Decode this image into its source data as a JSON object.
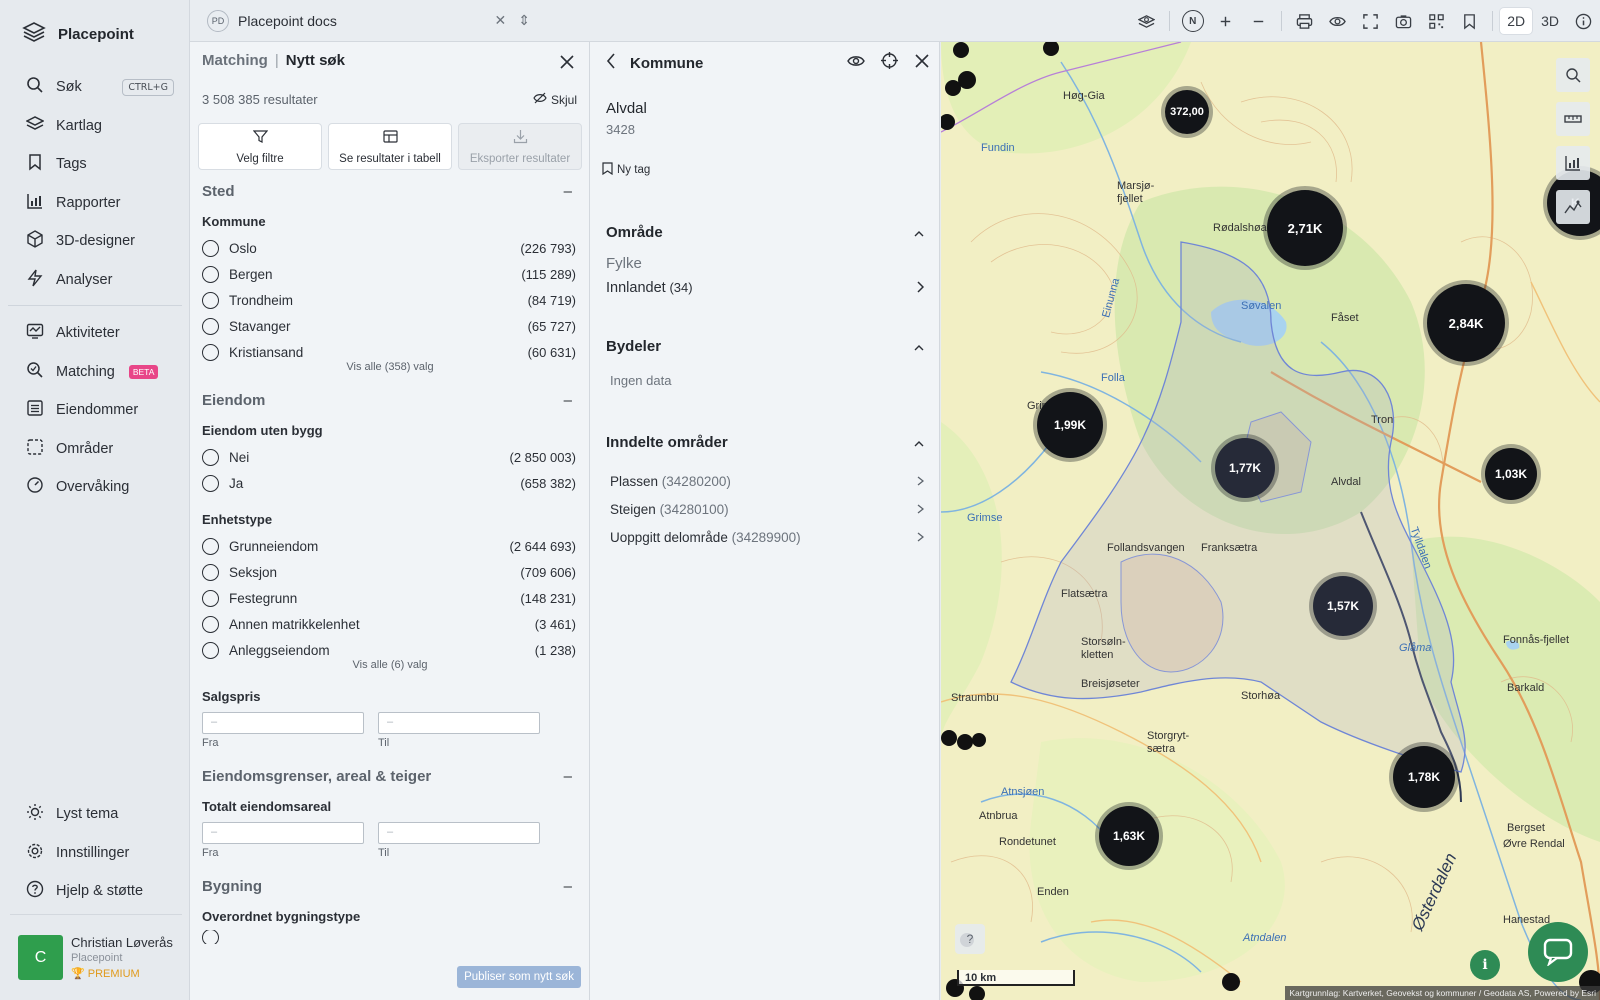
{
  "sidebar": {
    "brand": "Placepoint",
    "nav_main": [
      {
        "label": "Søk",
        "icon": "search-icon",
        "shortcut": "CTRL+G"
      },
      {
        "label": "Kartlag",
        "icon": "layers-icon"
      },
      {
        "label": "Tags",
        "icon": "bookmark-icon"
      },
      {
        "label": "Rapporter",
        "icon": "bar-chart-icon"
      },
      {
        "label": "3D-designer",
        "icon": "cube-icon"
      },
      {
        "label": "Analyser",
        "icon": "lightning-icon"
      }
    ],
    "nav_secondary": [
      {
        "label": "Aktiviteter",
        "icon": "activity-icon"
      },
      {
        "label": "Matching",
        "icon": "match-search-icon",
        "badge": "BETA"
      },
      {
        "label": "Eiendommer",
        "icon": "list-icon"
      },
      {
        "label": "Områder",
        "icon": "area-icon"
      },
      {
        "label": "Overvåking",
        "icon": "gauge-icon"
      }
    ],
    "nav_bottom": [
      {
        "label": "Lyst tema",
        "icon": "sun-icon"
      },
      {
        "label": "Innstillinger",
        "icon": "gear-icon"
      },
      {
        "label": "Hjelp & støtte",
        "icon": "help-icon"
      }
    ],
    "user": {
      "initial": "C",
      "name": "Christian Løverås",
      "org": "Placepoint",
      "plan": "PREMIUM"
    }
  },
  "topbar": {
    "doc_initials": "PD",
    "doc_title": "Placepoint docs",
    "compass": "N",
    "mode_2d": "2D",
    "mode_3d": "3D"
  },
  "matching": {
    "title_prefix": "Matching",
    "title": "Nytt søk",
    "result_count": "3 508 385 resultater",
    "hide_label": "Skjul",
    "actions": {
      "filters": "Velg filtre",
      "table": "Se resultater i tabell",
      "export": "Eksporter resultater"
    },
    "sections": {
      "sted": {
        "title": "Sted",
        "group": "Kommune",
        "options": [
          {
            "label": "Oslo",
            "count": "(226 793)"
          },
          {
            "label": "Bergen",
            "count": "(115 289)"
          },
          {
            "label": "Trondheim",
            "count": "(84 719)"
          },
          {
            "label": "Stavanger",
            "count": "(65 727)"
          },
          {
            "label": "Kristiansand",
            "count": "(60 631)"
          }
        ],
        "show_all": "Vis alle (358) valg"
      },
      "eiendom": {
        "title": "Eiendom",
        "group1": "Eiendom uten bygg",
        "options1": [
          {
            "label": "Nei",
            "count": "(2 850 003)"
          },
          {
            "label": "Ja",
            "count": "(658 382)"
          }
        ],
        "group2": "Enhetstype",
        "options2": [
          {
            "label": "Grunneiendom",
            "count": "(2 644 693)"
          },
          {
            "label": "Seksjon",
            "count": "(709 606)"
          },
          {
            "label": "Festegrunn",
            "count": "(148 231)"
          },
          {
            "label": "Annen matrikkelenhet",
            "count": "(3 461)"
          },
          {
            "label": "Anleggseiendom",
            "count": "(1 238)"
          }
        ],
        "show_all": "Vis alle (6) valg",
        "group3": "Salgspris",
        "from_placeholder": "–",
        "to_placeholder": "–",
        "from_label": "Fra",
        "to_label": "Til"
      },
      "grenser": {
        "title": "Eiendomsgrenser, areal & teiger",
        "group": "Totalt eiendomsareal",
        "from_placeholder": "–",
        "to_placeholder": "–",
        "from_label": "Fra",
        "to_label": "Til"
      },
      "bygning": {
        "title": "Bygning",
        "group": "Overordnet bygningstype"
      }
    },
    "publish": "Publiser som nytt søk"
  },
  "kommune": {
    "title": "Kommune",
    "name": "Alvdal",
    "code": "3428",
    "new_tag": "Ny tag",
    "omrade": {
      "title": "Område",
      "label": "Fylke",
      "value": "Innlandet",
      "count": "(34)"
    },
    "bydeler": {
      "title": "Bydeler",
      "empty": "Ingen data"
    },
    "inndelte": {
      "title": "Inndelte områder",
      "items": [
        {
          "label": "Plassen",
          "code": "(34280200)"
        },
        {
          "label": "Steigen",
          "code": "(34280100)"
        },
        {
          "label": "Uoppgitt delområde",
          "code": "(34289900)"
        }
      ]
    }
  },
  "map": {
    "clusters": [
      "372,00",
      "2,71K",
      "2,84K",
      "1,99K",
      "1,77K",
      "1,03K",
      "1,57K",
      "1,78K",
      "1,63K",
      "K"
    ],
    "places": [
      "Høg-Gia",
      "Marsjø-fjellet",
      "Rødalshøa",
      "Fåset",
      "Folla",
      "Grimsa",
      "Tron",
      "Alvdal",
      "Franksætra",
      "Follandsvangen",
      "Flatsætra",
      "Storsøln-kletten",
      "Breisjøseter",
      "Storhøa",
      "Glåma",
      "Fonnås-fjellet",
      "Barkald",
      "Straumbu",
      "Storgryt-sætra",
      "Atnbrua",
      "Atnsjøen",
      "Rondetunet",
      "Enden",
      "Øvre Rendal",
      "Bergset",
      "Hanestad",
      "Østerdalen",
      "Atndalen",
      "Søvalen",
      "Einunna",
      "Grimse",
      "Fundin",
      "Tylldalen"
    ],
    "scale": "10 km",
    "attribution": "Kartgrunnlag: Kartverket, Geovekst og kommuner / Geodata AS, Powered by Esri"
  }
}
